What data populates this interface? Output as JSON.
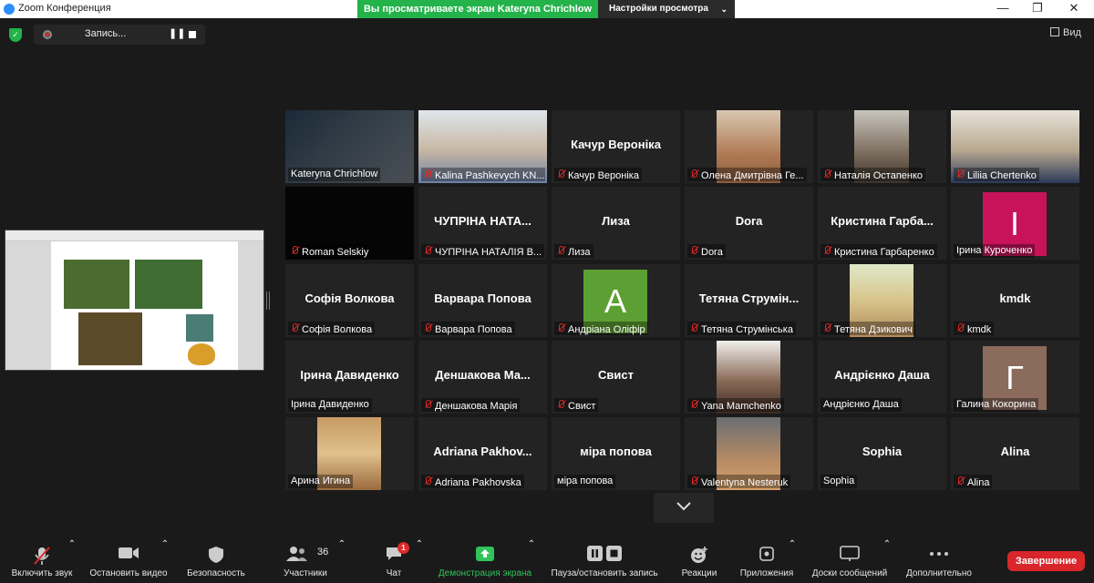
{
  "titlebar": {
    "app_title": "Zoom Конференция",
    "share_banner": "Вы просматриваете экран Kateryna Chrichlow",
    "view_options": "Настройки просмотра"
  },
  "recording": {
    "label": "Запись..."
  },
  "view_button": {
    "label": "Вид"
  },
  "colors": {
    "share_green": "#24b24a",
    "end_red": "#d9262b",
    "active_border": "#e5f06d",
    "muted_red": "#e02828"
  },
  "participants": [
    {
      "label": "Kateryna Chrichlow",
      "muted": false,
      "video": true,
      "active": true
    },
    {
      "label": "Kalina Pashkevych KN...",
      "muted": true,
      "video": true
    },
    {
      "big": "Качур Вероніка",
      "label": "Качур Вероніка",
      "muted": true
    },
    {
      "label": "Олена Дмитрівна Ге...",
      "muted": true,
      "video": true
    },
    {
      "label": "Наталія Остапенко",
      "muted": true,
      "video": true
    },
    {
      "label": "Liliia Chertenko",
      "muted": true,
      "video": true
    },
    {
      "label": "Roman Selskiy",
      "muted": true,
      "video": true
    },
    {
      "big": "ЧУПРІНА НАТА...",
      "label": "ЧУПРІНА НАТАЛІЯ В...",
      "muted": true
    },
    {
      "big": "Лиза",
      "label": "Лиза",
      "muted": true
    },
    {
      "big": "Dora",
      "label": "Dora",
      "muted": true
    },
    {
      "big": "Кристина Гарба...",
      "label": "Кристина Гарбаренко",
      "muted": true
    },
    {
      "avatar": "I",
      "label": "Ірина Куроченко",
      "muted": false
    },
    {
      "big": "Софія Волкова",
      "label": "Софія Волкова",
      "muted": true
    },
    {
      "big": "Варвара Попова",
      "label": "Варвара Попова",
      "muted": true
    },
    {
      "avatar": "A",
      "label": "Андріана Оліфір",
      "muted": true
    },
    {
      "big": "Тетяна Струмін...",
      "label": "Тетяна Струмінська",
      "muted": true
    },
    {
      "label": "Тетяна Дзикович",
      "muted": true,
      "video": true
    },
    {
      "big": "kmdk",
      "label": "kmdk",
      "muted": true
    },
    {
      "big": "Ірина Давиденко",
      "label": "Ірина Давиденко",
      "muted": false
    },
    {
      "big": "Деншакова Ма...",
      "label": "Деншакова Марія",
      "muted": true
    },
    {
      "big": "Свист",
      "label": "Свист",
      "muted": true
    },
    {
      "label": "Yana Mamchenko",
      "muted": true,
      "video": true
    },
    {
      "big": "Андрієнко Даша",
      "label": "Андрієнко Даша",
      "muted": false
    },
    {
      "avatar": "Г",
      "label": "Галина Кокорина",
      "muted": false
    },
    {
      "label": "Арина Игина",
      "muted": false,
      "video": true
    },
    {
      "big": "Adriana Pakhov...",
      "label": "Adriana Pakhovska",
      "muted": true
    },
    {
      "big": "міра попова",
      "label": "міра попова",
      "muted": false
    },
    {
      "label": "Valentyna Nesteruk",
      "muted": true,
      "video": true
    },
    {
      "big": "Sophia",
      "label": "Sophia",
      "muted": false
    },
    {
      "big": "Alina",
      "label": "Alina",
      "muted": true
    }
  ],
  "toolbar": {
    "mic": "Включить звук",
    "video": "Остановить видео",
    "security": "Безопасность",
    "participants": "Участники",
    "participants_count": "36",
    "chat": "Чат",
    "chat_badge": "1",
    "share": "Демонстрация экрана",
    "record": "Пауза/остановить запись",
    "reactions": "Реакции",
    "apps": "Приложения",
    "whiteboards": "Доски сообщений",
    "more": "Дополнительно",
    "end": "Завершение"
  }
}
